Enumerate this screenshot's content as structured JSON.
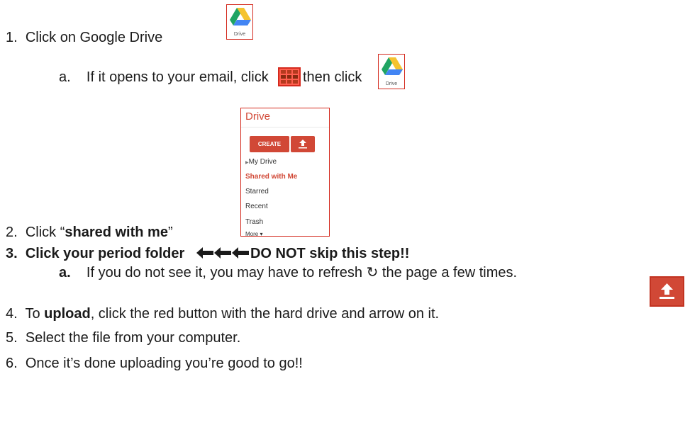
{
  "steps": {
    "s1": {
      "num": "1.",
      "text": "Click on Google Drive"
    },
    "s1a": {
      "num": "a.",
      "pre": "If it opens to your email, click",
      "post": "then click"
    },
    "s2": {
      "num": "2.",
      "pre": "Click “",
      "bold": "shared with me",
      "post": "”"
    },
    "s3": {
      "num": "3.",
      "text": "Click your period folder",
      "arrows": "🡄🡄🡄",
      "warn": "DO NOT skip this step!!"
    },
    "s3a": {
      "num": "a.",
      "pre": "If you do not see it, you may have to refresh",
      "refresh": "↻",
      "post": "the page a few times."
    },
    "s4": {
      "num": "4.",
      "pre": "To",
      "bold": "upload",
      "post": ", click the red button with the hard drive and arrow on it."
    },
    "s5": {
      "num": "5.",
      "text": "Select the file from your computer."
    },
    "s6": {
      "num": "6.",
      "text": "Once it’s done uploading you’re good to go!!"
    }
  },
  "drive_icon": {
    "caption": "Drive"
  },
  "drive_panel": {
    "title": "Drive",
    "create_label": "CREATE",
    "items": [
      "My Drive",
      "Shared with Me",
      "Starred",
      "Recent",
      "Trash",
      "More ▾"
    ]
  },
  "colors": {
    "accent": "#d14836",
    "border": "#d42a1e"
  }
}
